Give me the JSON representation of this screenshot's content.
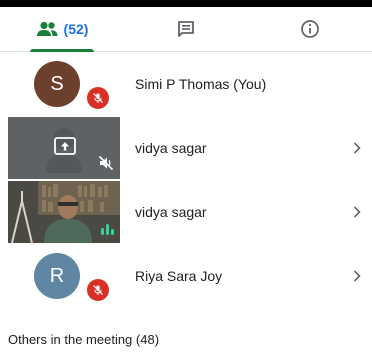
{
  "tabs": {
    "people_count": "(52)",
    "people_icon": "people-icon",
    "chat_icon": "chat-icon",
    "info_icon": "info-icon"
  },
  "participants": [
    {
      "initial": "S",
      "name": "Simi P Thomas (You)",
      "avatar_color": "#6d3f2d",
      "status": "muted"
    },
    {
      "name": "vidya sagar",
      "status": "presenting-muted"
    },
    {
      "name": "vidya sagar",
      "status": "video-speaking"
    },
    {
      "initial": "R",
      "name": "Riya Sara Joy",
      "avatar_color": "#5f87a4",
      "status": "muted"
    }
  ],
  "others_heading": "Others in the meeting (48)",
  "colors": {
    "accent_green": "#188038",
    "accent_blue": "#1a73e8",
    "mute_red": "#d93025"
  }
}
